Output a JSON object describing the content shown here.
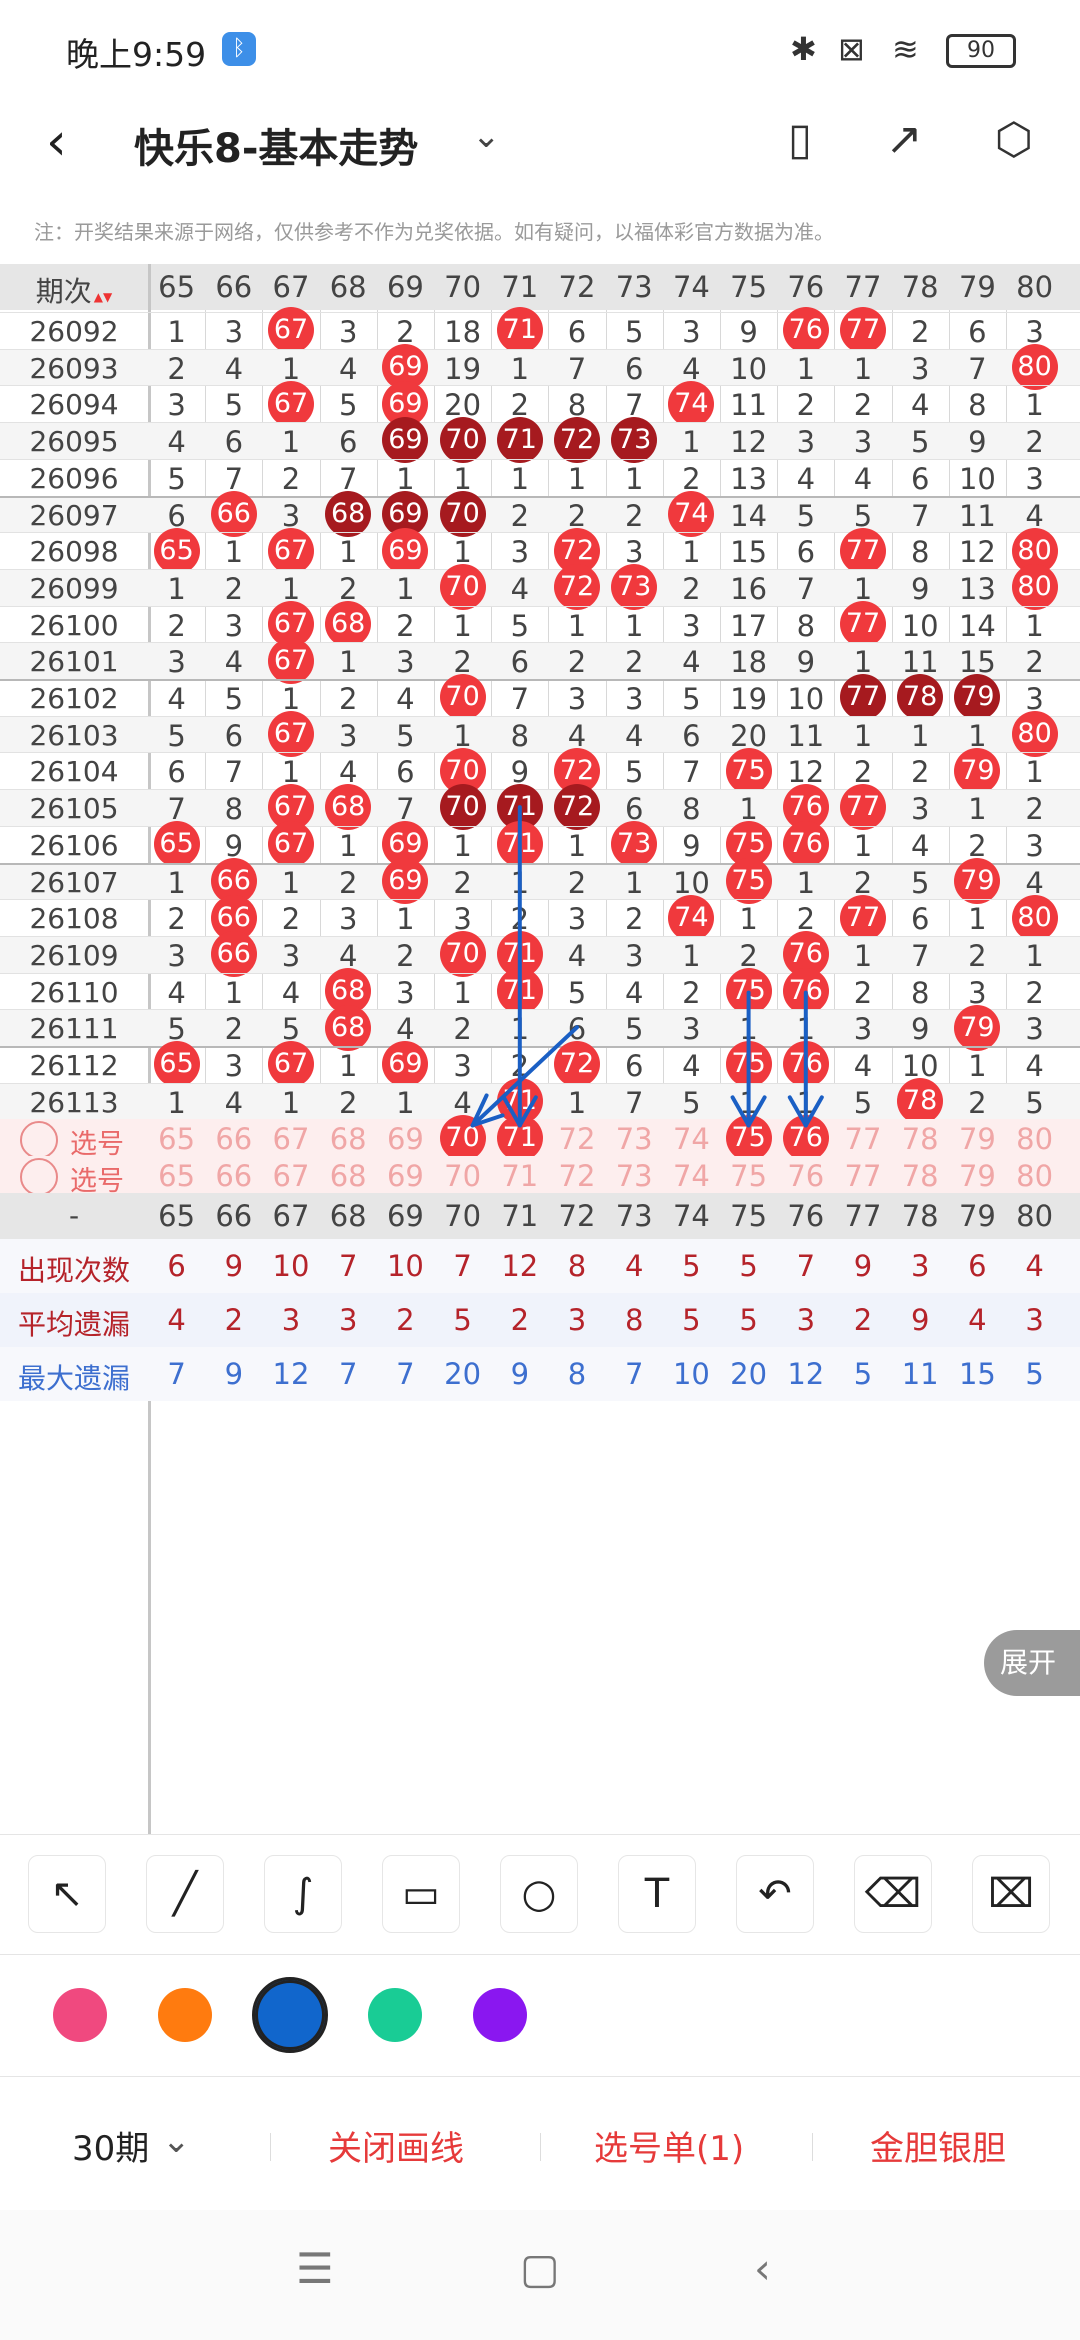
{
  "status": {
    "time": "晚上9:59",
    "bt_badge": "ᛒ",
    "bluetooth": "✱",
    "sim": "⊠",
    "wifi": "≋",
    "battery": "90"
  },
  "header": {
    "back": "‹",
    "title": "快乐8-基本走势",
    "dropdown": "⌄",
    "icons": [
      "phone-rotate-icon",
      "share-icon",
      "settings-icon"
    ],
    "icon_glyphs": [
      "▯",
      "↗",
      "⬡"
    ]
  },
  "notice": "注：开奖结果来源于网络，仅供参考不作为兑奖依据。如有疑问，以福体彩官方数据为准。",
  "table": {
    "period_header": "期次",
    "sort_glyph": "▲▼",
    "columns": [
      "65",
      "66",
      "67",
      "68",
      "69",
      "70",
      "71",
      "72",
      "73",
      "74",
      "75",
      "76",
      "77",
      "78",
      "79",
      "80"
    ],
    "rows": [
      {
        "period": "26092",
        "cells": [
          "1",
          "3",
          "67",
          "3",
          "2",
          "18",
          "71",
          "6",
          "5",
          "3",
          "9",
          "76",
          "77",
          "2",
          "6",
          "3"
        ],
        "hit": [
          0,
          0,
          1,
          0,
          0,
          0,
          1,
          0,
          0,
          0,
          0,
          1,
          1,
          0,
          0,
          0
        ]
      },
      {
        "period": "26093",
        "cells": [
          "2",
          "4",
          "1",
          "4",
          "69",
          "19",
          "1",
          "7",
          "6",
          "4",
          "10",
          "1",
          "1",
          "3",
          "7",
          "80"
        ],
        "hit": [
          0,
          0,
          0,
          0,
          1,
          0,
          0,
          0,
          0,
          0,
          0,
          0,
          0,
          0,
          0,
          1
        ]
      },
      {
        "period": "26094",
        "cells": [
          "3",
          "5",
          "67",
          "5",
          "69",
          "20",
          "2",
          "8",
          "7",
          "74",
          "11",
          "2",
          "2",
          "4",
          "8",
          "1"
        ],
        "hit": [
          0,
          0,
          1,
          0,
          1,
          0,
          0,
          0,
          0,
          1,
          0,
          0,
          0,
          0,
          0,
          0
        ]
      },
      {
        "period": "26095",
        "cells": [
          "4",
          "6",
          "1",
          "6",
          "69",
          "70",
          "71",
          "72",
          "73",
          "1",
          "12",
          "3",
          "3",
          "5",
          "9",
          "2"
        ],
        "hit": [
          0,
          0,
          0,
          0,
          2,
          2,
          2,
          2,
          2,
          0,
          0,
          0,
          0,
          0,
          0,
          0
        ]
      },
      {
        "period": "26096",
        "cells": [
          "5",
          "7",
          "2",
          "7",
          "1",
          "1",
          "1",
          "1",
          "1",
          "2",
          "13",
          "4",
          "4",
          "6",
          "10",
          "3"
        ],
        "hit": [
          0,
          0,
          0,
          0,
          0,
          0,
          0,
          0,
          0,
          0,
          0,
          0,
          0,
          0,
          0,
          0
        ]
      },
      {
        "period": "26097",
        "cells": [
          "6",
          "66",
          "3",
          "68",
          "69",
          "70",
          "2",
          "2",
          "2",
          "74",
          "14",
          "5",
          "5",
          "7",
          "11",
          "4"
        ],
        "hit": [
          0,
          1,
          0,
          2,
          2,
          2,
          0,
          0,
          0,
          1,
          0,
          0,
          0,
          0,
          0,
          0
        ]
      },
      {
        "period": "26098",
        "cells": [
          "65",
          "1",
          "67",
          "1",
          "69",
          "1",
          "3",
          "72",
          "3",
          "1",
          "15",
          "6",
          "77",
          "8",
          "12",
          "80"
        ],
        "hit": [
          1,
          0,
          1,
          0,
          1,
          0,
          0,
          1,
          0,
          0,
          0,
          0,
          1,
          0,
          0,
          1
        ]
      },
      {
        "period": "26099",
        "cells": [
          "1",
          "2",
          "1",
          "2",
          "1",
          "70",
          "4",
          "72",
          "73",
          "2",
          "16",
          "7",
          "1",
          "9",
          "13",
          "80"
        ],
        "hit": [
          0,
          0,
          0,
          0,
          0,
          1,
          0,
          1,
          1,
          0,
          0,
          0,
          0,
          0,
          0,
          1
        ]
      },
      {
        "period": "26100",
        "cells": [
          "2",
          "3",
          "67",
          "68",
          "2",
          "1",
          "5",
          "1",
          "1",
          "3",
          "17",
          "8",
          "77",
          "10",
          "14",
          "1"
        ],
        "hit": [
          0,
          0,
          1,
          1,
          0,
          0,
          0,
          0,
          0,
          0,
          0,
          0,
          1,
          0,
          0,
          0
        ]
      },
      {
        "period": "26101",
        "cells": [
          "3",
          "4",
          "67",
          "1",
          "3",
          "2",
          "6",
          "2",
          "2",
          "4",
          "18",
          "9",
          "1",
          "11",
          "15",
          "2"
        ],
        "hit": [
          0,
          0,
          1,
          0,
          0,
          0,
          0,
          0,
          0,
          0,
          0,
          0,
          0,
          0,
          0,
          0
        ]
      },
      {
        "period": "26102",
        "cells": [
          "4",
          "5",
          "1",
          "2",
          "4",
          "70",
          "7",
          "3",
          "3",
          "5",
          "19",
          "10",
          "77",
          "78",
          "79",
          "3"
        ],
        "hit": [
          0,
          0,
          0,
          0,
          0,
          1,
          0,
          0,
          0,
          0,
          0,
          0,
          2,
          2,
          2,
          0
        ]
      },
      {
        "period": "26103",
        "cells": [
          "5",
          "6",
          "67",
          "3",
          "5",
          "1",
          "8",
          "4",
          "4",
          "6",
          "20",
          "11",
          "1",
          "1",
          "1",
          "80"
        ],
        "hit": [
          0,
          0,
          1,
          0,
          0,
          0,
          0,
          0,
          0,
          0,
          0,
          0,
          0,
          0,
          0,
          1
        ]
      },
      {
        "period": "26104",
        "cells": [
          "6",
          "7",
          "1",
          "4",
          "6",
          "70",
          "9",
          "72",
          "5",
          "7",
          "75",
          "12",
          "2",
          "2",
          "79",
          "1"
        ],
        "hit": [
          0,
          0,
          0,
          0,
          0,
          1,
          0,
          1,
          0,
          0,
          1,
          0,
          0,
          0,
          1,
          0
        ]
      },
      {
        "period": "26105",
        "cells": [
          "7",
          "8",
          "67",
          "68",
          "7",
          "70",
          "71",
          "72",
          "6",
          "8",
          "1",
          "76",
          "77",
          "3",
          "1",
          "2"
        ],
        "hit": [
          0,
          0,
          1,
          1,
          0,
          2,
          2,
          2,
          0,
          0,
          0,
          1,
          1,
          0,
          0,
          0
        ]
      },
      {
        "period": "26106",
        "cells": [
          "65",
          "9",
          "67",
          "1",
          "69",
          "1",
          "71",
          "1",
          "73",
          "9",
          "75",
          "76",
          "1",
          "4",
          "2",
          "3"
        ],
        "hit": [
          1,
          0,
          1,
          0,
          1,
          0,
          1,
          0,
          1,
          0,
          1,
          1,
          0,
          0,
          0,
          0
        ]
      },
      {
        "period": "26107",
        "cells": [
          "1",
          "66",
          "1",
          "2",
          "69",
          "2",
          "1",
          "2",
          "1",
          "10",
          "75",
          "1",
          "2",
          "5",
          "79",
          "4"
        ],
        "hit": [
          0,
          1,
          0,
          0,
          1,
          0,
          0,
          0,
          0,
          0,
          1,
          0,
          0,
          0,
          1,
          0
        ]
      },
      {
        "period": "26108",
        "cells": [
          "2",
          "66",
          "2",
          "3",
          "1",
          "3",
          "2",
          "3",
          "2",
          "74",
          "1",
          "2",
          "77",
          "6",
          "1",
          "80"
        ],
        "hit": [
          0,
          1,
          0,
          0,
          0,
          0,
          0,
          0,
          0,
          1,
          0,
          0,
          1,
          0,
          0,
          1
        ]
      },
      {
        "period": "26109",
        "cells": [
          "3",
          "66",
          "3",
          "4",
          "2",
          "70",
          "71",
          "4",
          "3",
          "1",
          "2",
          "76",
          "1",
          "7",
          "2",
          "1"
        ],
        "hit": [
          0,
          1,
          0,
          0,
          0,
          1,
          1,
          0,
          0,
          0,
          0,
          1,
          0,
          0,
          0,
          0
        ]
      },
      {
        "period": "26110",
        "cells": [
          "4",
          "1",
          "4",
          "68",
          "3",
          "1",
          "71",
          "5",
          "4",
          "2",
          "75",
          "76",
          "2",
          "8",
          "3",
          "2"
        ],
        "hit": [
          0,
          0,
          0,
          1,
          0,
          0,
          1,
          0,
          0,
          0,
          1,
          1,
          0,
          0,
          0,
          0
        ]
      },
      {
        "period": "26111",
        "cells": [
          "5",
          "2",
          "5",
          "68",
          "4",
          "2",
          "1",
          "6",
          "5",
          "3",
          "1",
          "1",
          "3",
          "9",
          "79",
          "3"
        ],
        "hit": [
          0,
          0,
          0,
          1,
          0,
          0,
          0,
          0,
          0,
          0,
          0,
          0,
          0,
          0,
          1,
          0
        ]
      },
      {
        "period": "26112",
        "cells": [
          "65",
          "3",
          "67",
          "1",
          "69",
          "3",
          "2",
          "72",
          "6",
          "4",
          "75",
          "76",
          "4",
          "10",
          "1",
          "4"
        ],
        "hit": [
          1,
          0,
          1,
          0,
          1,
          0,
          0,
          1,
          0,
          0,
          1,
          1,
          0,
          0,
          0,
          0
        ]
      },
      {
        "period": "26113",
        "cells": [
          "1",
          "4",
          "1",
          "2",
          "1",
          "4",
          "71",
          "1",
          "7",
          "5",
          "1",
          "1",
          "5",
          "78",
          "2",
          "5"
        ],
        "hit": [
          0,
          0,
          0,
          0,
          0,
          0,
          1,
          0,
          0,
          0,
          0,
          0,
          0,
          1,
          0,
          0
        ]
      }
    ],
    "select_rows": [
      {
        "label": "选号",
        "selected": [
          0,
          0,
          0,
          0,
          0,
          1,
          1,
          0,
          0,
          0,
          1,
          1,
          0,
          0,
          0,
          0
        ]
      },
      {
        "label": "选号",
        "selected": [
          0,
          0,
          0,
          0,
          0,
          0,
          0,
          0,
          0,
          0,
          0,
          0,
          0,
          0,
          0,
          0
        ]
      }
    ],
    "footer_header_label": "-",
    "stats": [
      {
        "label": "出现次数",
        "values": [
          "6",
          "9",
          "10",
          "7",
          "10",
          "7",
          "12",
          "8",
          "4",
          "5",
          "5",
          "7",
          "9",
          "3",
          "6",
          "4"
        ],
        "color": "#b5232a"
      },
      {
        "label": "平均遗漏",
        "values": [
          "4",
          "2",
          "3",
          "3",
          "2",
          "5",
          "2",
          "3",
          "8",
          "5",
          "5",
          "3",
          "2",
          "9",
          "4",
          "3"
        ],
        "color": "#b5232a"
      },
      {
        "label": "最大遗漏",
        "values": [
          "7",
          "9",
          "12",
          "7",
          "7",
          "20",
          "9",
          "8",
          "7",
          "10",
          "20",
          "12",
          "5",
          "11",
          "15",
          "5"
        ],
        "color": "#3d6fcf"
      }
    ],
    "expand_label": "展开"
  },
  "tools": [
    {
      "name": "select-arrow-tool",
      "glyph": "↖"
    },
    {
      "name": "line-tool",
      "glyph": "╱"
    },
    {
      "name": "curve-tool",
      "glyph": "∫"
    },
    {
      "name": "rectangle-tool",
      "glyph": "▭"
    },
    {
      "name": "circle-tool",
      "glyph": "○"
    },
    {
      "name": "text-tool",
      "glyph": "T"
    },
    {
      "name": "undo-tool",
      "glyph": "↶"
    },
    {
      "name": "eraser-tool",
      "glyph": "⌫"
    },
    {
      "name": "clear-tool",
      "glyph": "⌧"
    }
  ],
  "colors": [
    "#f0497f",
    "#ff7b0f",
    "#1166cc",
    "#19cc95",
    "#8a17f0"
  ],
  "selected_color_index": 2,
  "bottom": {
    "periods": "30期",
    "periods_chevron": "⌄",
    "close_lines": "关闭画线",
    "selection_list": "选号单(1)",
    "gold_silver": "金胆银胆"
  },
  "navbar": {
    "menu": "☰",
    "home": "▢",
    "back": "‹"
  }
}
